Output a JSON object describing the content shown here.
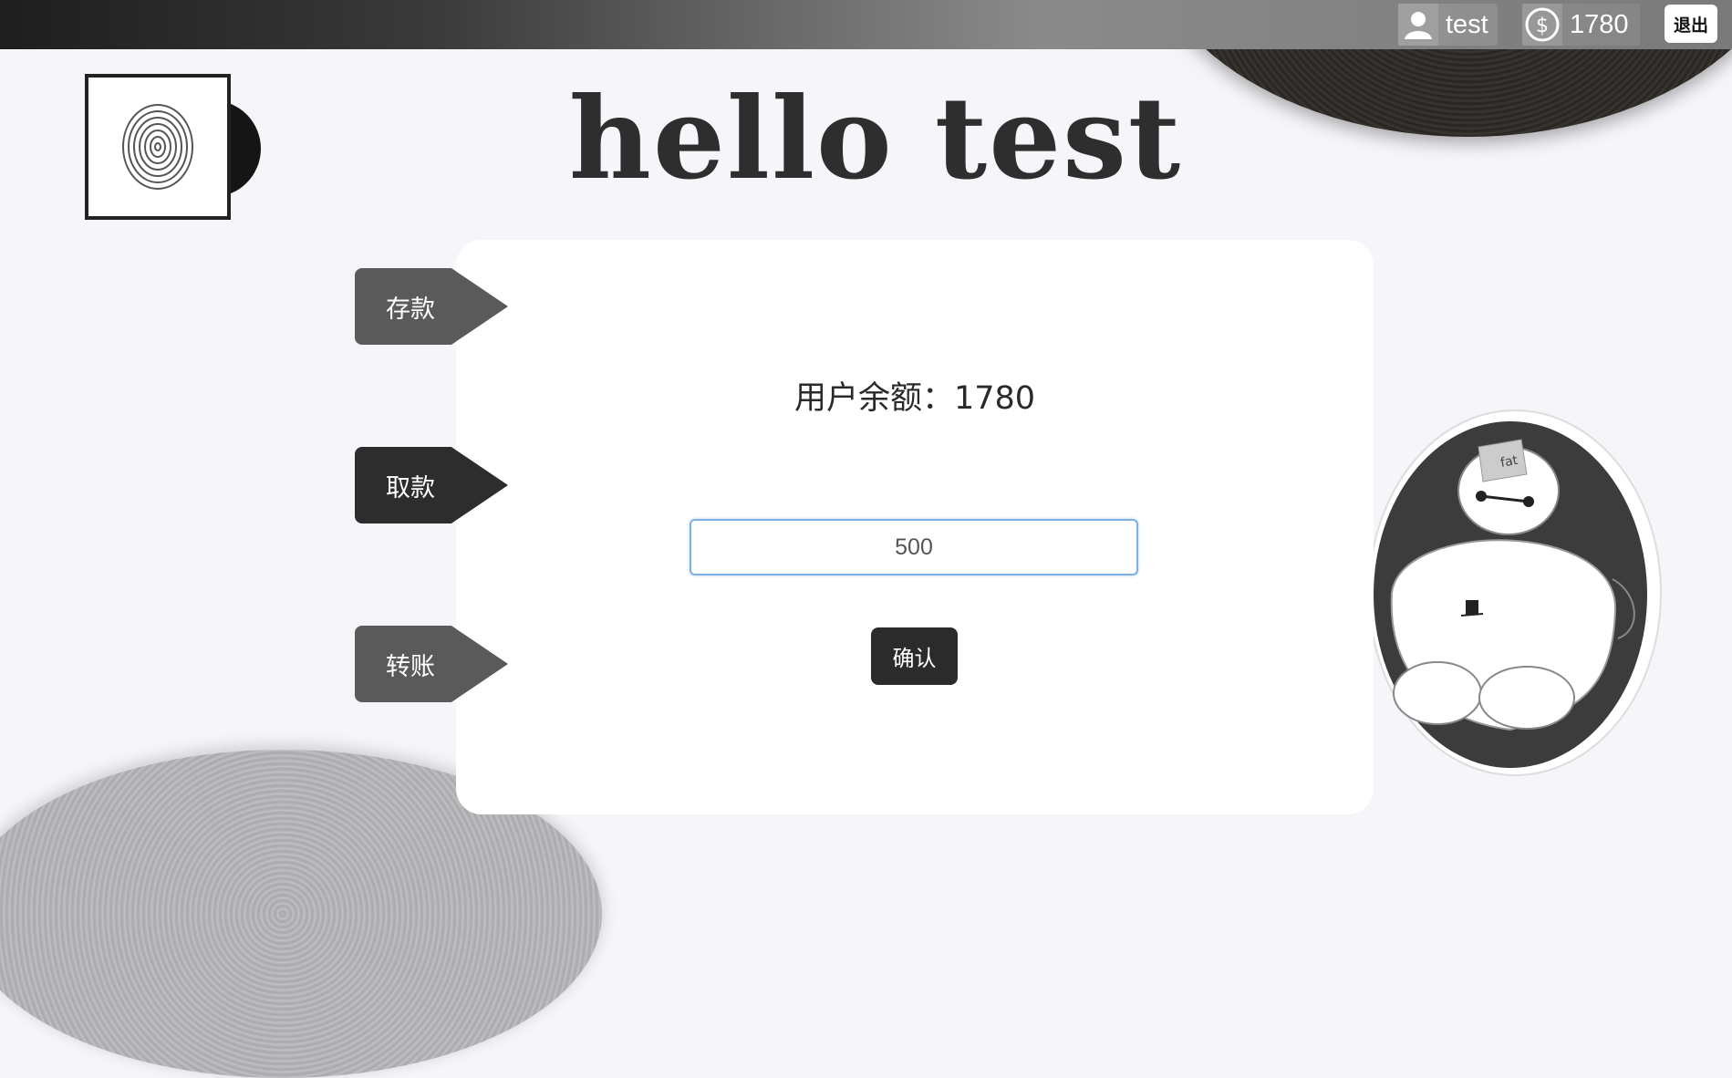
{
  "header": {
    "username": "test",
    "coins": "1780",
    "logout_label": "退出"
  },
  "title": "hello test",
  "tabs": [
    {
      "label": "存款",
      "active": false
    },
    {
      "label": "取款",
      "active": true
    },
    {
      "label": "转账",
      "active": false
    }
  ],
  "panel": {
    "balance_text": "用户余额：1780",
    "amount_value": "500",
    "confirm_label": "确认"
  },
  "sticker": {
    "hat_text": "fat"
  },
  "colors": {
    "accent_dark": "#2d2d2d",
    "tab_gray": "#5a5a5a",
    "input_focus": "#7fb0e4"
  }
}
